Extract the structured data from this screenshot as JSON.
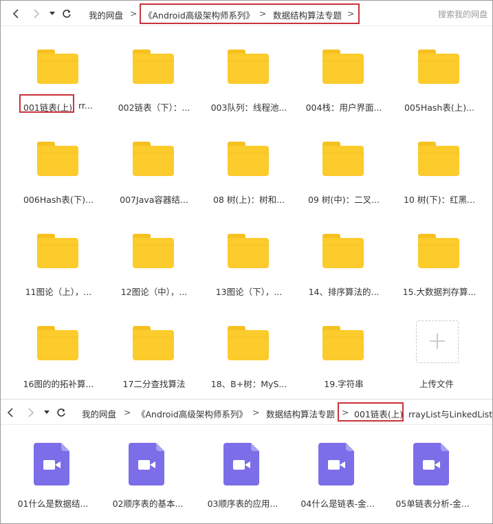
{
  "top_nav": {
    "crumbs": [
      "我的网盘",
      "《Android高级架构师系列》",
      "数据结构算法专题"
    ],
    "separator": ">",
    "search_placeholder": "搜索我的网盘"
  },
  "folders": [
    {
      "name": "001链表(上)"
    },
    {
      "name": "002链表（下）：..."
    },
    {
      "name": "003队列：线程池..."
    },
    {
      "name": "004栈：用户界面..."
    },
    {
      "name": "005Hash表(上)..."
    },
    {
      "name": "006Hash表(下)..."
    },
    {
      "name": "007Java容器结..."
    },
    {
      "name": "08 树(上)：树和..."
    },
    {
      "name": "09 树(中)：二叉..."
    },
    {
      "name": "10 树(下)：红黑..."
    },
    {
      "name": "11图论（上），..."
    },
    {
      "name": "12图论（中），..."
    },
    {
      "name": "13图论（下），..."
    },
    {
      "name": "14、排序算法的..."
    },
    {
      "name": "15.大数据判存算..."
    },
    {
      "name": "16图的的拓补算..."
    },
    {
      "name": "17二分查找算法"
    },
    {
      "name": "18、B+树：MyS..."
    },
    {
      "name": "19.字符串"
    }
  ],
  "folder_extra_text": "rr...",
  "upload": {
    "label": "上传文件"
  },
  "bottom_nav": {
    "crumbs": [
      "我的网盘",
      "《Android高级架构师系列》",
      "数据结构算法专题",
      "001链表(上)"
    ],
    "trailing_text": "rrayList与LinkedList源",
    "separator": ">"
  },
  "videos": [
    {
      "name": "01什么是数据结..."
    },
    {
      "name": "02顺序表的基本..."
    },
    {
      "name": "03顺序表的应用..."
    },
    {
      "name": "04什么是链表-金..."
    },
    {
      "name": "05单链表分析-金..."
    }
  ],
  "colors": {
    "highlight": "#c8333a",
    "folder": "#fccb2c",
    "video": "#7b6ee8"
  }
}
